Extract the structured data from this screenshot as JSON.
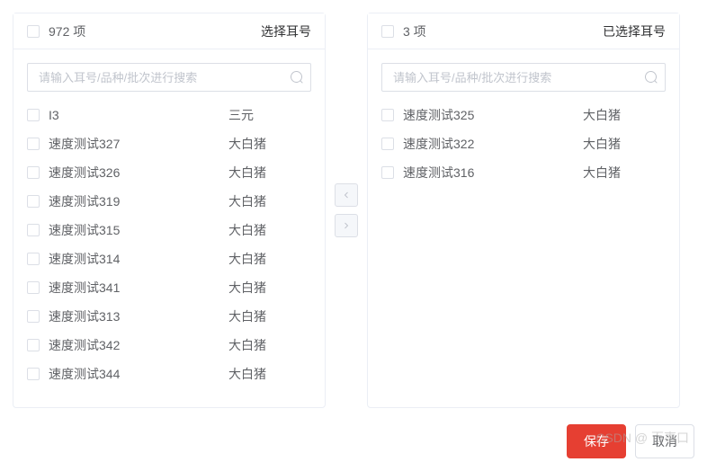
{
  "left_panel": {
    "count_label": "972 项",
    "header_title": "选择耳号",
    "search_placeholder": "请输入耳号/品种/批次进行搜索",
    "items": [
      {
        "name": "I3",
        "breed": "三元"
      },
      {
        "name": "速度测试327",
        "breed": "大白猪"
      },
      {
        "name": "速度测试326",
        "breed": "大白猪"
      },
      {
        "name": "速度测试319",
        "breed": "大白猪"
      },
      {
        "name": "速度测试315",
        "breed": "大白猪"
      },
      {
        "name": "速度测试314",
        "breed": "大白猪"
      },
      {
        "name": "速度测试341",
        "breed": "大白猪"
      },
      {
        "name": "速度测试313",
        "breed": "大白猪"
      },
      {
        "name": "速度测试342",
        "breed": "大白猪"
      },
      {
        "name": "速度测试344",
        "breed": "大白猪"
      }
    ]
  },
  "right_panel": {
    "count_label": "3 项",
    "header_title": "已选择耳号",
    "search_placeholder": "请输入耳号/品种/批次进行搜索",
    "items": [
      {
        "name": "速度测试325",
        "breed": "大白猪"
      },
      {
        "name": "速度测试322",
        "breed": "大白猪"
      },
      {
        "name": "速度测试316",
        "breed": "大白猪"
      }
    ]
  },
  "buttons": {
    "save": "保存",
    "cancel": "取消"
  },
  "watermark": "CSDN @ 百事口"
}
